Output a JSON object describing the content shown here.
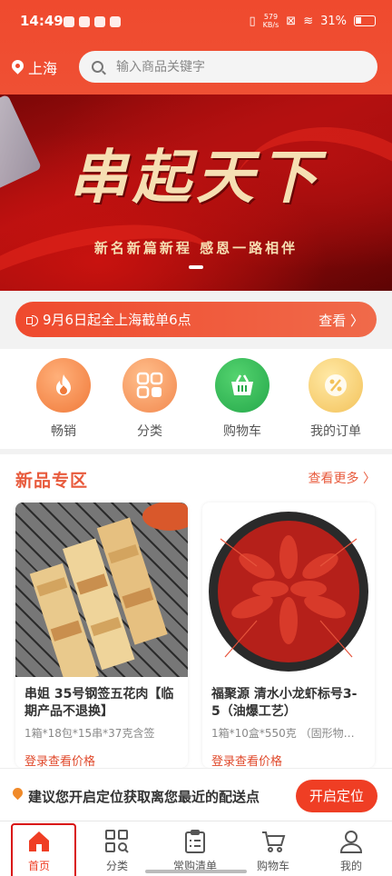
{
  "status": {
    "time": "14:49",
    "speed_top": "579",
    "speed_bottom": "KB/s",
    "battery": "31%"
  },
  "header": {
    "location": "上海",
    "search_placeholder": "输入商品关键字"
  },
  "banner": {
    "title": "串起天下",
    "subtitle": "新名新篇新程 感恩一路相伴"
  },
  "notice": {
    "text": "9月6日起全上海截单6点",
    "more": "查看 〉"
  },
  "quick": [
    {
      "label": "畅销",
      "icon": "fire-icon"
    },
    {
      "label": "分类",
      "icon": "category-icon"
    },
    {
      "label": "购物车",
      "icon": "basket-icon"
    },
    {
      "label": "我的订单",
      "icon": "order-icon"
    }
  ],
  "new_zone": {
    "title": "新品专区",
    "more": "查看更多 〉",
    "products": [
      {
        "name": "串姐 35号钢签五花肉【临期产品不退换】",
        "spec": "1箱*18包*15串*37克含签",
        "price": "登录查看价格"
      },
      {
        "name": "福聚源 清水小龙虾标号3-5（油爆工艺）",
        "spec": "1箱*10盒*550克 （固形物…",
        "price": "登录查看价格"
      }
    ]
  },
  "location_bar": {
    "text": "建议您开启定位获取离您最近的配送点",
    "button": "开启定位"
  },
  "tabs": [
    {
      "label": "首页",
      "icon": "home-icon"
    },
    {
      "label": "分类",
      "icon": "grid-search-icon"
    },
    {
      "label": "常购清单",
      "icon": "clipboard-icon"
    },
    {
      "label": "购物车",
      "icon": "cart-icon"
    },
    {
      "label": "我的",
      "icon": "user-icon"
    }
  ],
  "colors": {
    "primary": "#ef4a2e",
    "accent_text": "#e85a3c",
    "tab_active": "#ef3e24"
  }
}
